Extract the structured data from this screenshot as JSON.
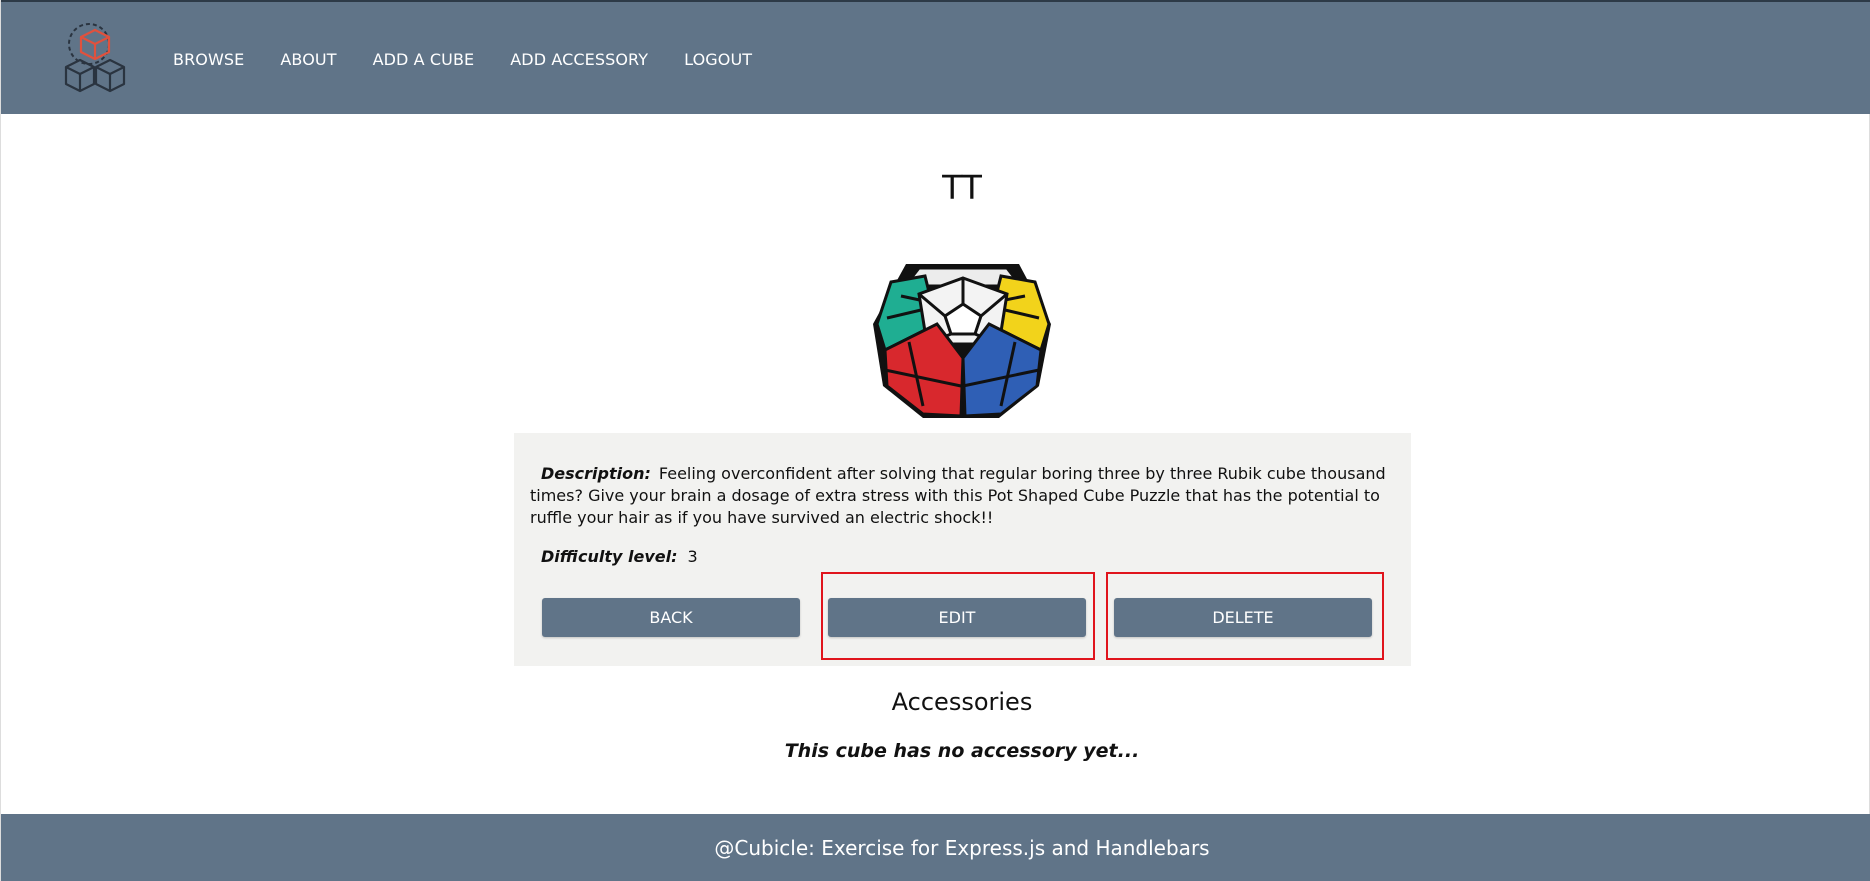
{
  "header": {
    "nav": [
      {
        "label": "BROWSE"
      },
      {
        "label": "ABOUT"
      },
      {
        "label": "ADD A CUBE"
      },
      {
        "label": "ADD ACCESSORY"
      },
      {
        "label": "LOGOUT"
      }
    ]
  },
  "cube": {
    "title": "TT",
    "image_alt": "megaminx-cube-image",
    "description_label": "Description:",
    "description": "Feeling overconfident after solving that regular boring three by three Rubik cube thousand times? Give your brain a dosage of extra stress with this Pot Shaped Cube Puzzle that has the potential to ruffle your hair as if you have survived an electric shock!!",
    "difficulty_label": "Difficulty level:",
    "difficulty": "3"
  },
  "actions": {
    "back": "BACK",
    "edit": "EDIT",
    "delete": "DELETE"
  },
  "accessories": {
    "title": "Accessories",
    "empty": "This cube has no accessory yet..."
  },
  "footer": {
    "text": "@Cubicle: Exercise for Express.js and Handlebars"
  },
  "colors": {
    "header_bg": "#607488",
    "panel_bg": "#f2f2f0",
    "highlight": "#e0141c",
    "logo_accent": "#e0513d"
  }
}
